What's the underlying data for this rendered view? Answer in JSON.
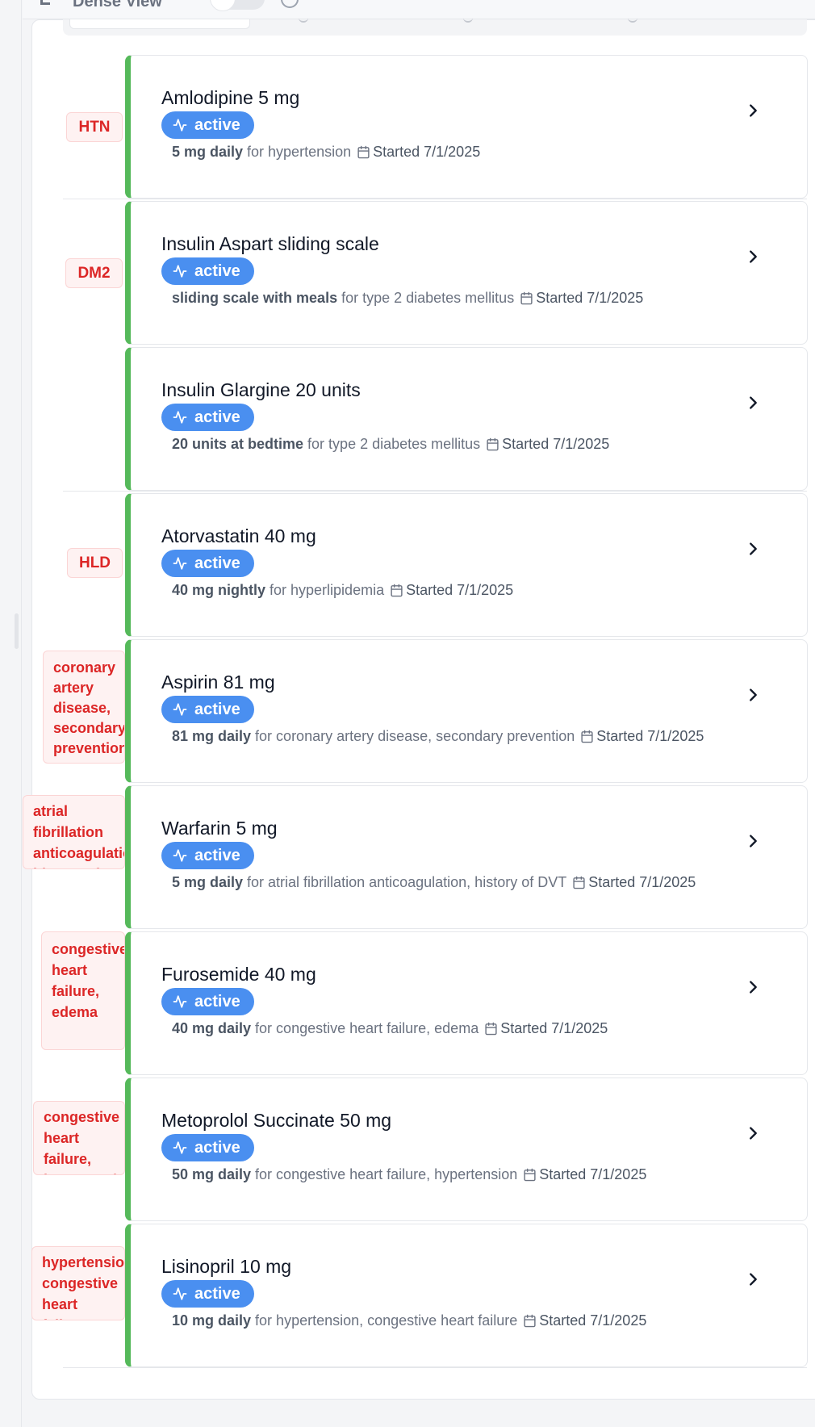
{
  "toolbar": {
    "view_label": "Dense View",
    "toggle_on": false
  },
  "colors": {
    "accent_badge": "#4a8ff0",
    "card_stripe": "#55b95a",
    "dx_tag_text": "#dc2626",
    "dx_tag_bg": "#fef2f2"
  },
  "medications": [
    {
      "dx": "HTN",
      "name": "Amlodipine 5 mg",
      "status": "active",
      "dose": "5 mg daily",
      "for_text": "for hypertension",
      "started": "Started 7/1/2025"
    },
    {
      "dx": "DM2",
      "name": "Insulin Aspart sliding scale",
      "status": "active",
      "dose": "sliding scale with meals",
      "for_text": "for type 2 diabetes mellitus",
      "started": "Started 7/1/2025"
    },
    {
      "dx": "",
      "name": "Insulin Glargine 20 units",
      "status": "active",
      "dose": "20 units at bedtime",
      "for_text": "for type 2 diabetes mellitus",
      "started": "Started 7/1/2025"
    },
    {
      "dx": "HLD",
      "name": "Atorvastatin 40 mg",
      "status": "active",
      "dose": "40 mg nightly",
      "for_text": "for hyperlipidemia",
      "started": "Started 7/1/2025"
    },
    {
      "dx": "coronary\nartery\ndisease,\nsecondary\nprevention",
      "name": "Aspirin 81 mg",
      "status": "active",
      "dose": "81 mg daily",
      "for_text": "for coronary artery disease, secondary prevention",
      "started": "Started 7/1/2025"
    },
    {
      "dx": "atrial fibrillation\nanticoagulation,\nhistory of DVT",
      "name": "Warfarin 5 mg",
      "status": "active",
      "dose": "5 mg daily",
      "for_text": "for atrial fibrillation anticoagulation, history of DVT",
      "started": "Started 7/1/2025"
    },
    {
      "dx": "congestive\nheart\nfailure,\nedema",
      "name": "Furosemide 40 mg",
      "status": "active",
      "dose": "40 mg daily",
      "for_text": "for congestive heart failure, edema",
      "started": "Started 7/1/2025"
    },
    {
      "dx": "congestive\nheart failure,\nhypertension",
      "name": "Metoprolol Succinate 50 mg",
      "status": "active",
      "dose": "50 mg daily",
      "for_text": "for congestive heart failure, hypertension",
      "started": "Started 7/1/2025"
    },
    {
      "dx": "hypertension,\ncongestive\nheart failure",
      "name": "Lisinopril 10 mg",
      "status": "active",
      "dose": "10 mg daily",
      "for_text": "for hypertension, congestive heart failure",
      "started": "Started 7/1/2025"
    }
  ]
}
